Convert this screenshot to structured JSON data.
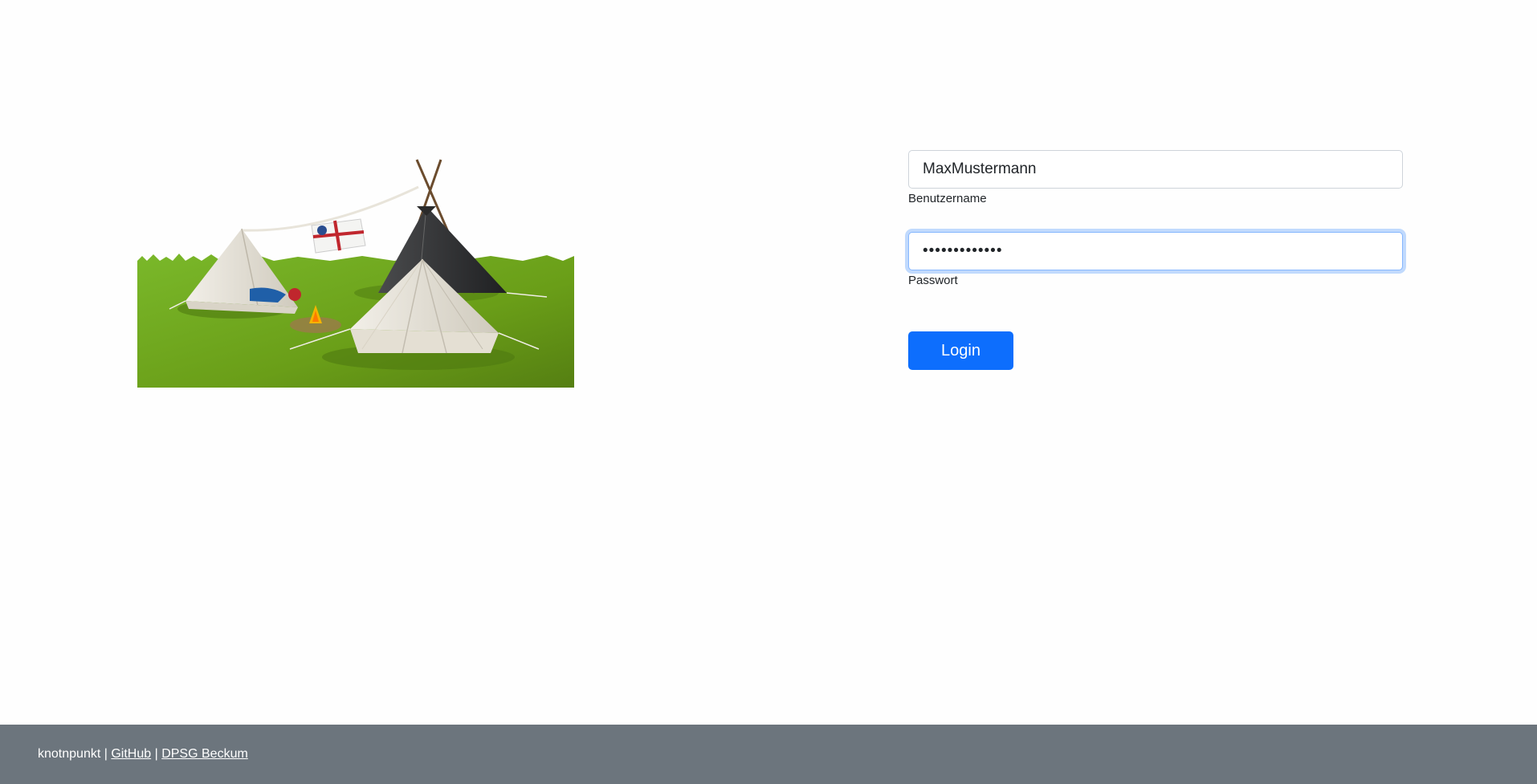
{
  "login": {
    "username_value": "MaxMustermann",
    "username_label": "Benutzername",
    "password_mask": "•••••••••••••",
    "password_label": "Passwort",
    "submit_label": "Login"
  },
  "footer": {
    "brand": "knotnpunkt",
    "separator": "|",
    "link_github": "GitHub",
    "link_dpsg": "DPSG Beckum"
  },
  "colors": {
    "primary": "#0d6efd",
    "footer_bg": "#6c757d",
    "grass": "#6fa61e"
  }
}
